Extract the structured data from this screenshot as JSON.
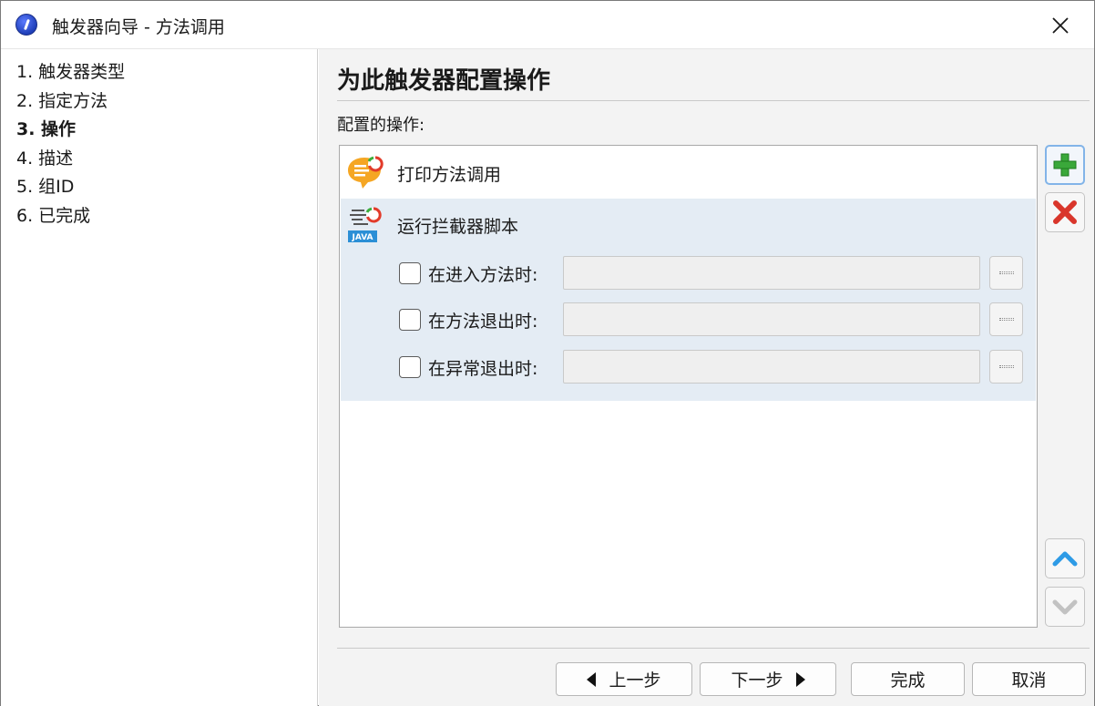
{
  "window": {
    "title": "触发器向导 - 方法调用"
  },
  "sidebar": {
    "steps": [
      {
        "label": "1. 触发器类型"
      },
      {
        "label": "2. 指定方法"
      },
      {
        "label": "3. 操作"
      },
      {
        "label": "4. 描述"
      },
      {
        "label": "5. 组ID"
      },
      {
        "label": "6. 已完成"
      }
    ],
    "active_index": 2
  },
  "main": {
    "heading": "为此触发器配置操作",
    "list_label": "配置的操作:",
    "actions": [
      {
        "label": "打印方法调用",
        "icon": "print-method-call-icon"
      },
      {
        "label": "运行拦截器脚本",
        "icon": "java-script-icon",
        "badge": "JAVA",
        "options": [
          {
            "label": "在进入方法时:",
            "checked": false,
            "value": ""
          },
          {
            "label": "在方法退出时:",
            "checked": false,
            "value": ""
          },
          {
            "label": "在异常退出时:",
            "checked": false,
            "value": ""
          }
        ]
      }
    ]
  },
  "side_buttons": {
    "add": "add-icon",
    "remove": "remove-icon",
    "move_up": "chevron-up-icon",
    "move_down": "chevron-down-icon"
  },
  "footer": {
    "back_label": "上一步",
    "next_label": "下一步",
    "finish_label": "完成",
    "cancel_label": "取消"
  },
  "colors": {
    "selected_row": "#e4ecf4",
    "add_green": "#3aa83a",
    "remove_red": "#d9362b",
    "up_blue": "#2e9be6",
    "down_gray": "#c2c2c2"
  }
}
